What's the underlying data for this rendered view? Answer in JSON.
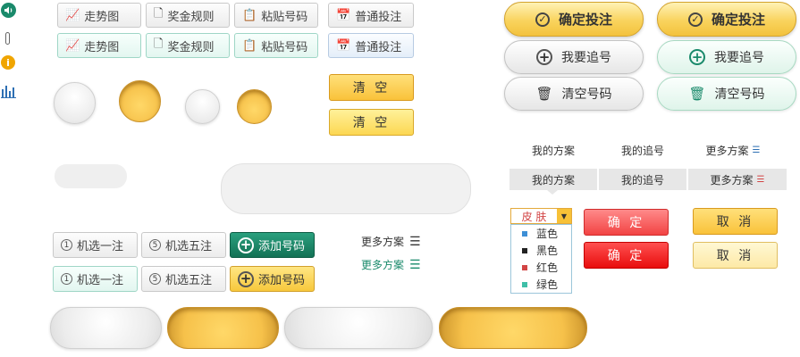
{
  "toolbar": {
    "trend": "走势图",
    "rules": "奖金规则",
    "paste": "粘贴号码",
    "normal": "普通投注"
  },
  "pills": {
    "confirm_bet": "确定投注",
    "follow": "我要追号",
    "clear_numbers": "清空号码"
  },
  "clear_label": "清 空",
  "tabs": {
    "my_plan": "我的方案",
    "my_follow": "我的追号",
    "more_plans": "更多方案"
  },
  "random": {
    "one": "机选一注",
    "five": "机选五注",
    "add": "添加号码",
    "one_num": "1",
    "five_num": "5"
  },
  "more_link": "更多方案",
  "skin": {
    "label": "皮 肤",
    "options": [
      {
        "label": "蓝色",
        "color": "#3d8fd6"
      },
      {
        "label": "黑色",
        "color": "#222222"
      },
      {
        "label": "红色",
        "color": "#d24545"
      },
      {
        "label": "绿色",
        "color": "#3fbfa8"
      }
    ]
  },
  "dialog": {
    "confirm": "确 定",
    "cancel": "取 消"
  },
  "colors": {
    "teal": "#1a8a6b",
    "gold": "#f9c23a",
    "orange_icon": "#f0a500"
  }
}
